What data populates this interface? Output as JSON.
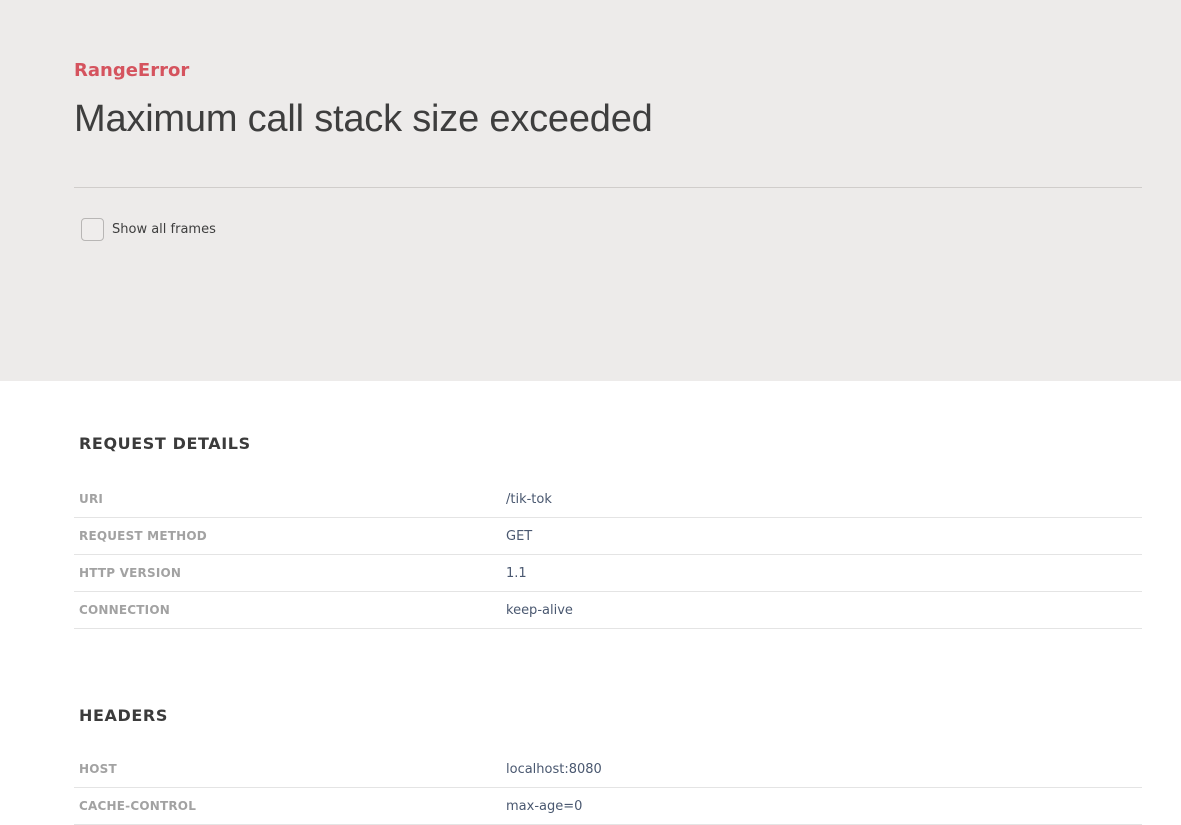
{
  "error": {
    "name": "RangeError",
    "message": "Maximum call stack size exceeded"
  },
  "frames_toggle": {
    "label": "Show all frames",
    "checked": false
  },
  "request_details": {
    "title": "REQUEST DETAILS",
    "rows": [
      {
        "key": "URI",
        "value": "/tik-tok"
      },
      {
        "key": "REQUEST METHOD",
        "value": "GET"
      },
      {
        "key": "HTTP VERSION",
        "value": "1.1"
      },
      {
        "key": "CONNECTION",
        "value": "keep-alive"
      }
    ]
  },
  "headers": {
    "title": "HEADERS",
    "rows": [
      {
        "key": "HOST",
        "value": "localhost:8080"
      },
      {
        "key": "CACHE-CONTROL",
        "value": "max-age=0"
      }
    ]
  },
  "colors": {
    "header_bg": "#edebea",
    "error_name": "#d5535e",
    "value_text": "#4a5870"
  }
}
